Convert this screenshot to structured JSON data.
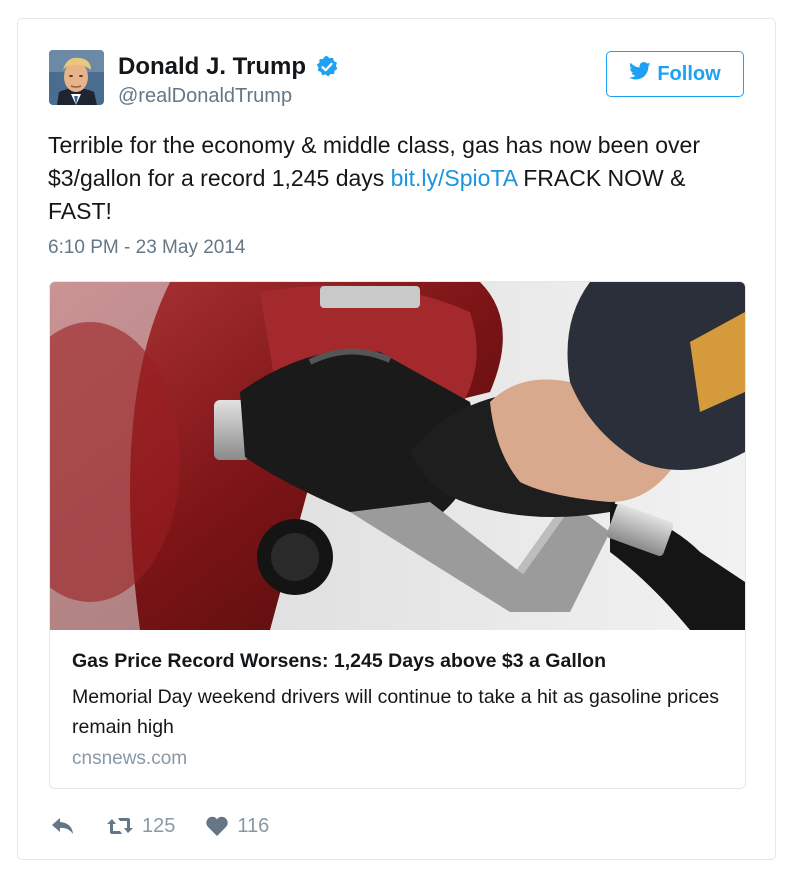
{
  "author": {
    "name": "Donald J. Trump",
    "handle": "@realDonaldTrump",
    "verified_icon": "verified-badge-icon"
  },
  "follow_button": {
    "label": "Follow",
    "icon": "twitter-bird-icon"
  },
  "tweet": {
    "text_before_link": "Terrible for the economy & middle class, gas has now been over $3/gallon for a record 1,245 days ",
    "link": "bit.ly/SpioTA",
    "text_after_link": " FRACK NOW & FAST!",
    "timestamp": "6:10 PM - 23 May 2014"
  },
  "card": {
    "image_icon": "gas-pump-nozzle-photo",
    "title": "Gas Price Record Worsens: 1,245 Days above $3 a Gallon",
    "description": "Memorial Day weekend drivers will continue to take a hit as gasoline prices remain high",
    "domain": "cnsnews.com"
  },
  "actions": {
    "reply_icon": "reply-icon",
    "retweet_icon": "retweet-icon",
    "retweet_count": "125",
    "like_icon": "heart-icon",
    "like_count": "116"
  },
  "colors": {
    "link": "#1b95e0",
    "follow": "#1da1f2",
    "muted": "#657786",
    "card_red": "#8e1a1c"
  }
}
